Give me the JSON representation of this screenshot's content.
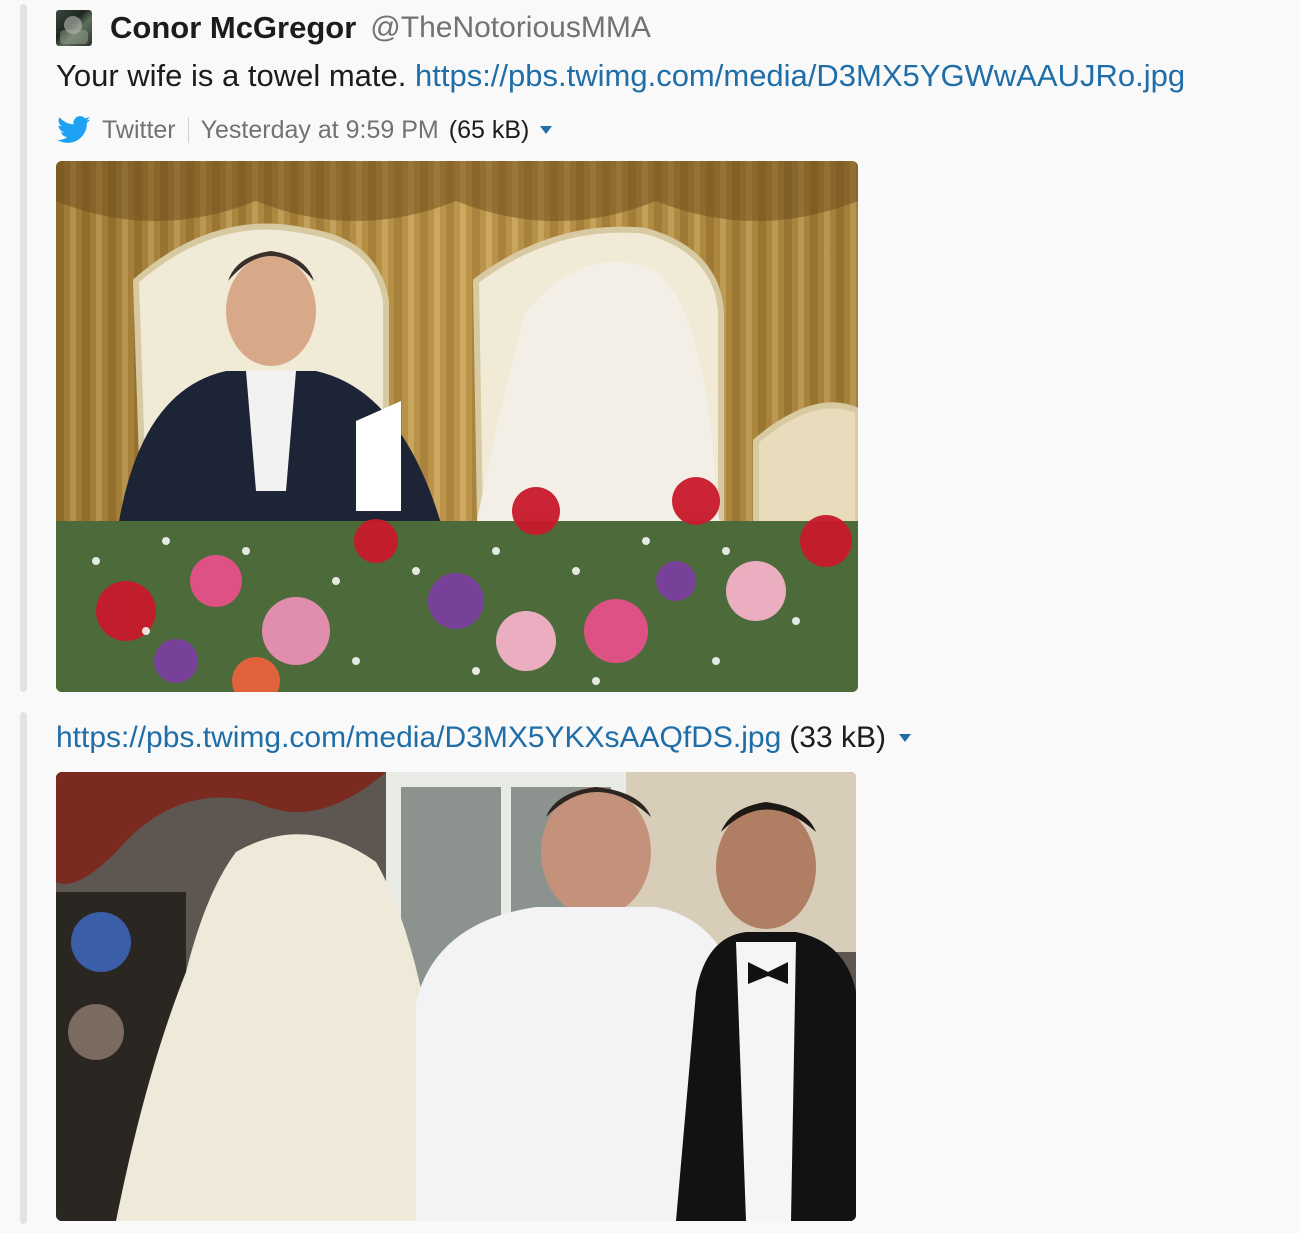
{
  "message": {
    "author_name": "Conor McGregor",
    "author_handle": "@TheNotoriousMMA",
    "text": "Your wife is a towel mate.",
    "link": "https://pbs.twimg.com/media/D3MX5YGWwAAUJRo.jpg",
    "source": "Twitter",
    "timestamp": "Yesterday at 9:59 PM",
    "size": "(65 kB)",
    "icons": [
      "twitter-bird-icon",
      "caret-down-icon"
    ]
  },
  "attachment2": {
    "link": "https://pbs.twimg.com/media/D3MX5YKXsAAQfDS.jpg",
    "size": "(33 kB)"
  },
  "colors": {
    "link": "#1f6ea8",
    "twitter_blue": "#1da1f2",
    "muted_text": "#717274",
    "quote_bar": "#e3e3e3"
  }
}
